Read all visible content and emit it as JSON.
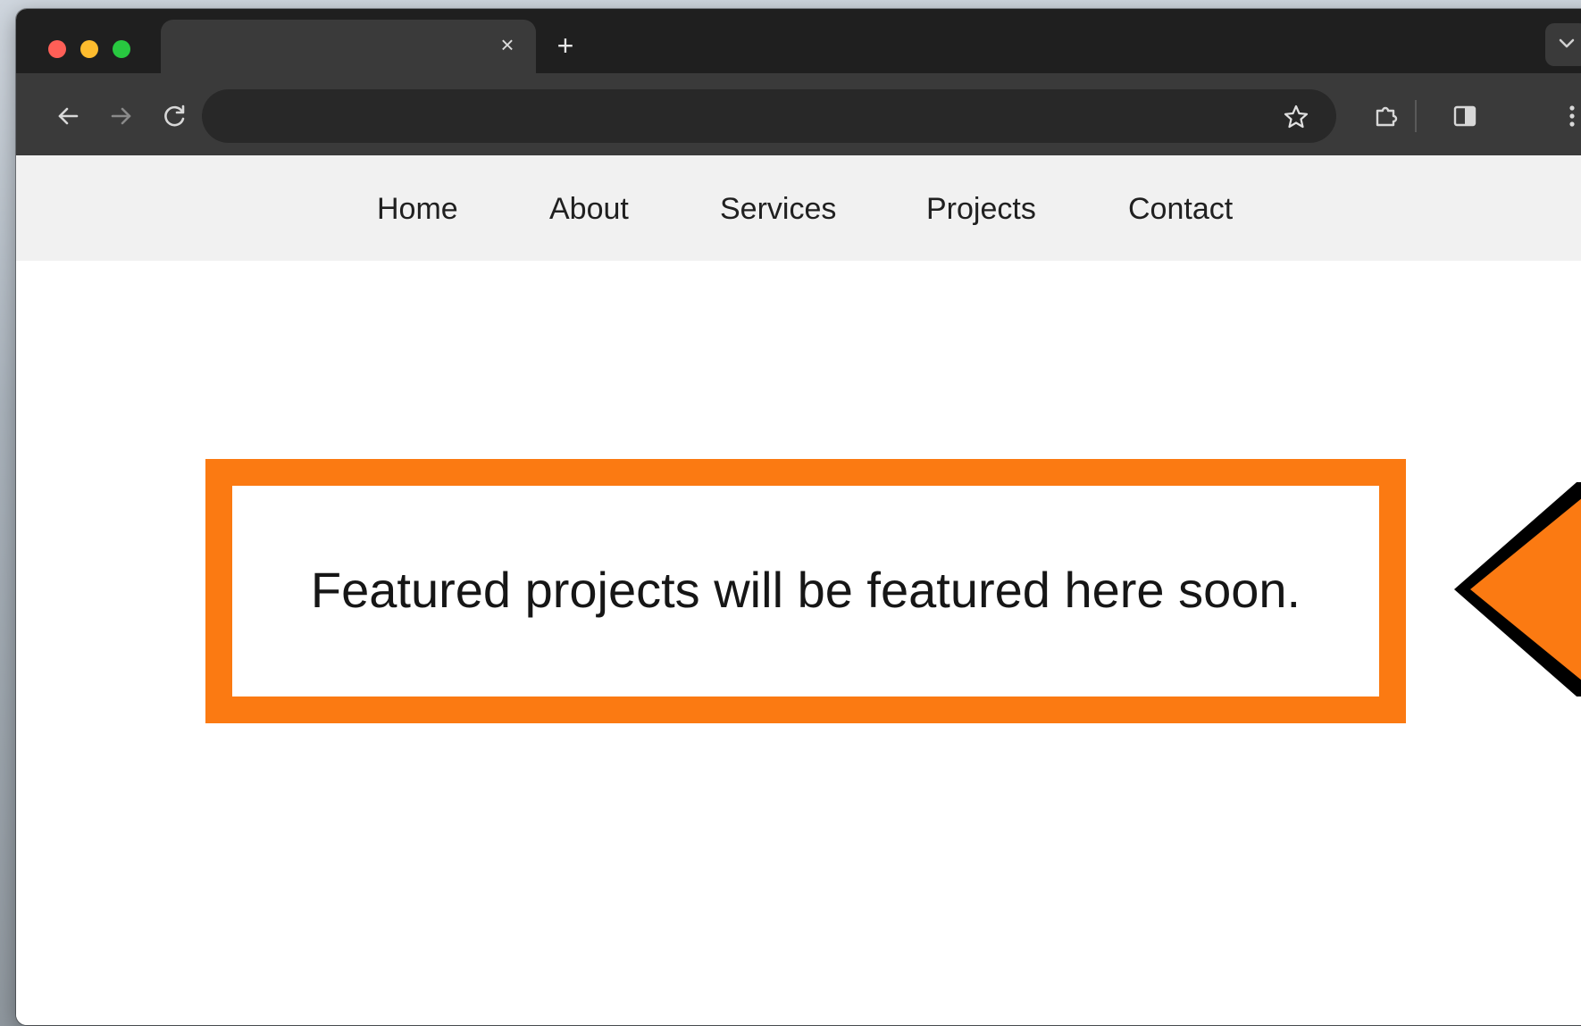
{
  "browser": {
    "new_tab_label": "+",
    "tab_close_label": "×"
  },
  "navbar": {
    "items": [
      {
        "label": "Home"
      },
      {
        "label": "About"
      },
      {
        "label": "Services"
      },
      {
        "label": "Projects"
      },
      {
        "label": "Contact"
      }
    ]
  },
  "main": {
    "callout_text": "Featured projects will be featured here soon."
  },
  "colors": {
    "accent_orange": "#fb7a12",
    "tabstrip": "#1f1f1f",
    "toolbar": "#3a3a3a",
    "navbar_bg": "#f1f1f1"
  }
}
